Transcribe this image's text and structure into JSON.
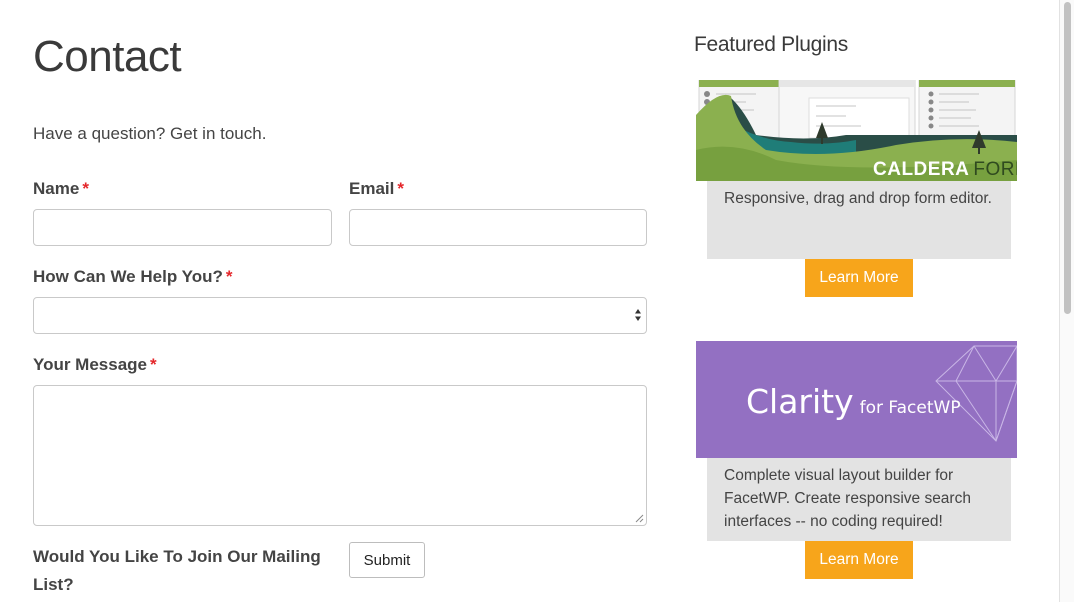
{
  "page": {
    "title": "Contact",
    "intro": "Have a question? Get in touch."
  },
  "form": {
    "required_mark": "*",
    "name_label": "Name",
    "name_value": "",
    "email_label": "Email",
    "email_value": "",
    "help_label": "How Can We Help You?",
    "help_selected": "",
    "message_label": "Your Message",
    "message_value": "",
    "mailing_label": "Would You Like To Join Our Mailing List?",
    "submit_label": "Submit"
  },
  "sidebar": {
    "title": "Featured Plugins",
    "plugins": [
      {
        "logo_text": "CALDERA FORMS",
        "logo_part1": "CALDERA",
        "logo_part2": "FORMS",
        "description": "Responsive, drag and drop form editor.",
        "button_label": "Learn More",
        "banner_color": "#8bb04f"
      },
      {
        "logo_text": "Clarity for FacetWP",
        "logo_main": "Clarity",
        "logo_sub": "for FacetWP",
        "description": "Complete visual layout builder for FacetWP. Create responsive search interfaces -- no coding required!",
        "button_label": "Learn More",
        "banner_color": "#9370c2"
      }
    ]
  },
  "colors": {
    "required": "#e4262a",
    "learn_more": "#f7a51b",
    "desc_background": "#e3e3e3"
  }
}
